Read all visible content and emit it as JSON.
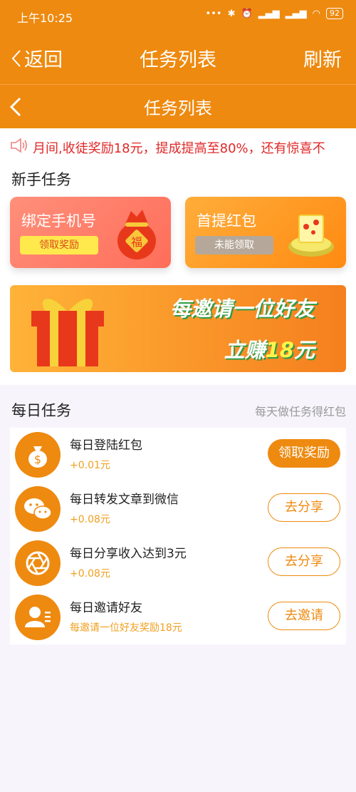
{
  "status_bar": {
    "time": "上午10:25",
    "battery": "92"
  },
  "app_bar": {
    "back_label": "返回",
    "title": "任务列表",
    "refresh_label": "刷新"
  },
  "page_header": {
    "title": "任务列表"
  },
  "notice": {
    "text": "月间,收徒奖励18元，提成提高至80%，还有惊喜不"
  },
  "newbie": {
    "section_title": "新手任务",
    "cards": [
      {
        "title": "绑定手机号",
        "action": "领取奖励"
      },
      {
        "title": "首提红包",
        "action": "未能领取"
      }
    ],
    "banner": {
      "line1": "每邀请一位好友",
      "line2_prefix": "立赚",
      "line2_number": "18",
      "line2_suffix": "元"
    }
  },
  "daily": {
    "section_title": "每日任务",
    "hint": "每天做任务得红包",
    "tasks": [
      {
        "name": "每日登陆红包",
        "reward": "+0.01元",
        "action": "领取奖励",
        "icon": "money-bag-icon"
      },
      {
        "name": "每日转发文章到微信",
        "reward": "+0.08元",
        "action": "去分享",
        "icon": "wechat-icon"
      },
      {
        "name": "每日分享收入达到3元",
        "reward": "+0.08元",
        "action": "去分享",
        "icon": "camera-shutter-icon"
      },
      {
        "name": "每日邀请好友",
        "reward": "每邀请一位好友奖励18元",
        "action": "去邀请",
        "icon": "user-card-icon"
      }
    ]
  },
  "colors": {
    "accent": "#ee8a0f",
    "notice_text": "#e02828",
    "reward_text": "#f0a020"
  }
}
